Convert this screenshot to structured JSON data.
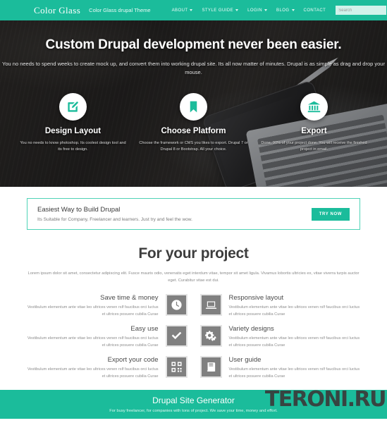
{
  "nav": {
    "brand": "Color Glass",
    "tagline": "Color Glass drupal Theme",
    "items": [
      {
        "label": "ABOUT",
        "caret": true
      },
      {
        "label": "STYLE GUIDE",
        "caret": true
      },
      {
        "label": "LOGIN",
        "caret": true
      },
      {
        "label": "BLOG",
        "caret": true
      },
      {
        "label": "CONTACT",
        "caret": false
      }
    ],
    "search": {
      "value": "",
      "placeholder": "Search",
      "icon": "search-icon"
    }
  },
  "hero": {
    "title": "Custom Drupal development never been easier.",
    "subtitle": "You no needs to spend weeks to create mock up, and convert them into working drupal site. Its all now matter of minutes. Drupal is as simple as drag and drop your mouse.",
    "columns": [
      {
        "icon": "pencil-edit-icon",
        "title": "Design Layout",
        "desc": "You no needs to know photoshop. Its coolest design tool and its free to design."
      },
      {
        "icon": "bookmark-icon",
        "title": "Choose Platform",
        "desc": "Choose the framework or CMS you likes to export. Drupal 7 or Drupal 8 or Bootstrap. All your choice."
      },
      {
        "icon": "bank-columns-icon",
        "title": "Export",
        "desc": "Done. 90% of your project done. You will receive the finished project in email."
      }
    ]
  },
  "cta": {
    "title": "Easiest Way to Build Drupal",
    "subtitle": "Its Suitable for Company, Freelancer and learners. Just try and feel the wow.",
    "button": "TRY NOW"
  },
  "project": {
    "title": "For your project",
    "lead": "Lorem ipsum dolor sit amet, consectetur adipiscing elit. Fusce mauris odio, venenatis eget interdum vitae, tempor sit amet ligula. Vivamus lobortis ultricies ex, vitae viverra turpis auctor eget. Curabitur vitae est dui.",
    "features": [
      {
        "icon": "clock-icon",
        "title": "Save time & money",
        "desc": "Vestibulum elementum ante vitae leo ultrices venen rslf faucibus orci luctus et ultrices posuere cubilia Curae",
        "align": "right"
      },
      {
        "icon": "laptop-icon",
        "title": "Responsive layout",
        "desc": "Vestibulum elementum ante vitae leo ultrices venen rslf faucibus orci luctus et ultrices posuere cubilia Curae",
        "align": "left"
      },
      {
        "icon": "check-icon",
        "title": "Easy use",
        "desc": "Vestibulum elementum ante vitae leo ultrices venen rslf faucibus orci luctus et ultrices posuere cubilia Curae",
        "align": "right"
      },
      {
        "icon": "gears-icon",
        "title": "Variety designs",
        "desc": "Vestibulum elementum ante vitae leo ultrices venen rslf faucibus orci luctus et ultrices posuere cubilia Curae",
        "align": "left"
      },
      {
        "icon": "qr-code-icon",
        "title": "Export your code",
        "desc": "Vestibulum elementum ante vitae leo ultrices venen rslf faucibus orci luctus et ultrices posuere cubilia Curae",
        "align": "right"
      },
      {
        "icon": "book-icon",
        "title": "User guide",
        "desc": "Vestibulum elementum ante vitae leo ultrices venen rslf faucibus orci luctus et ultrices posuere cubilia Curae",
        "align": "left"
      }
    ]
  },
  "footer": {
    "title": "Drupal Site Generator",
    "subtitle": "For busy freelancer, for companies with tons of project. We save your time, money and effort.",
    "watermark": "TERONI.RU"
  },
  "colors": {
    "brand_green": "#1bbc9b",
    "icon_gray": "#808080",
    "hero_dark": "#232323"
  }
}
